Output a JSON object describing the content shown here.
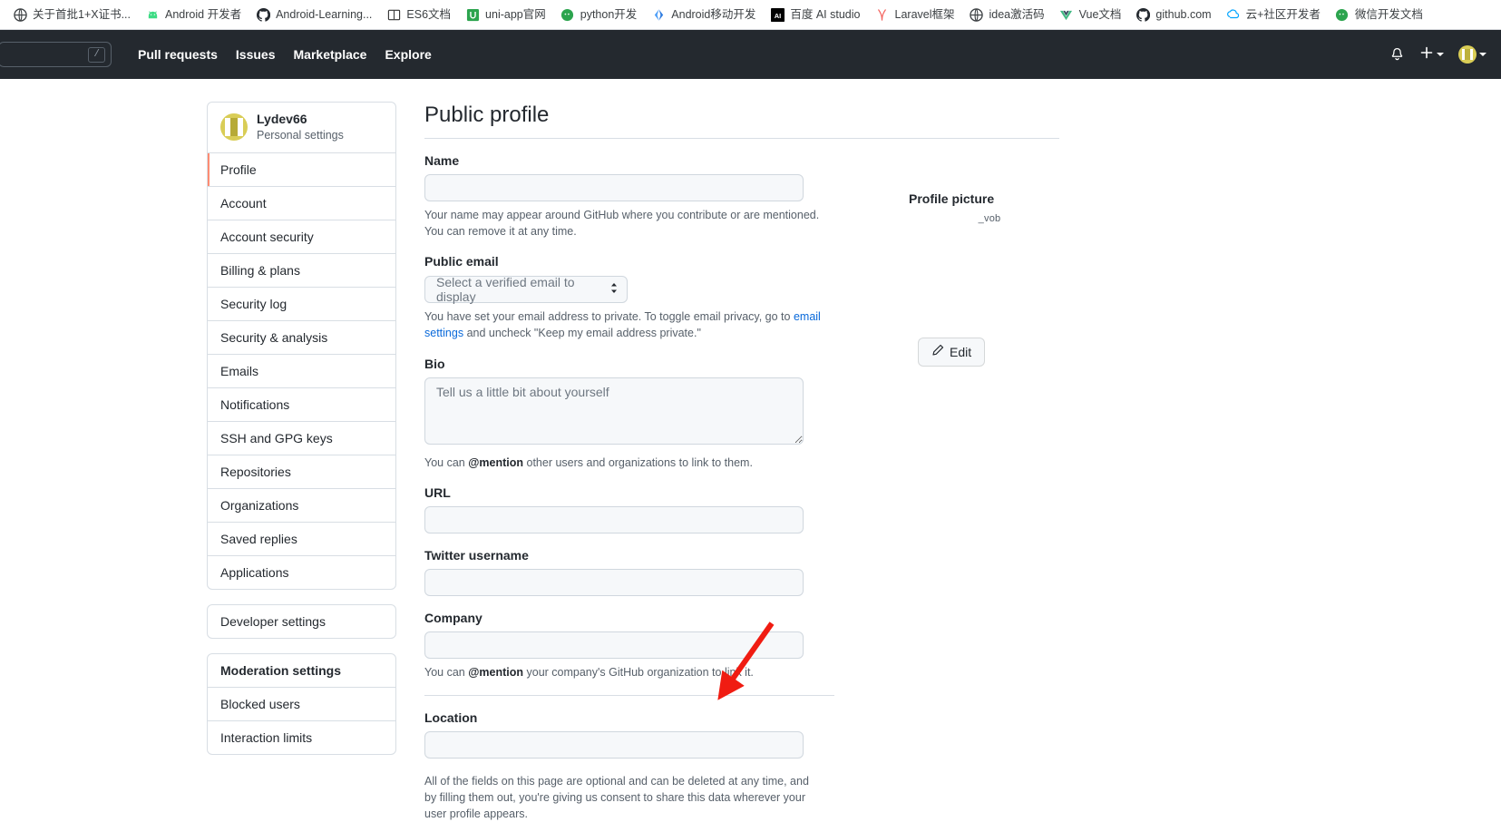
{
  "browser": {
    "bookmarks": [
      {
        "label": "关于首批1+X证书...",
        "icon": "globe-icon",
        "icon_glyph": "◍",
        "color": "#1a73e8"
      },
      {
        "label": "Android 开发者",
        "icon": "android-icon",
        "icon_glyph": "▲",
        "color": "#3ddc84"
      },
      {
        "label": "Android-Learning...",
        "icon": "github-icon",
        "icon_glyph": "",
        "color": "#24292f"
      },
      {
        "label": "ES6文档",
        "icon": "book-icon",
        "icon_glyph": "▥",
        "color": "#333333"
      },
      {
        "label": "uni-app官网",
        "icon": "uniapp-icon",
        "icon_glyph": "U",
        "color": "#2ca44e"
      },
      {
        "label": "python开发",
        "icon": "chat-icon",
        "icon_glyph": "●",
        "color": "#2ca44e"
      },
      {
        "label": "Android移动开发",
        "icon": "csdn-icon",
        "icon_glyph": "✦",
        "color": "#4a9df8"
      },
      {
        "label": "百度 AI studio",
        "icon": "ai-studio-icon",
        "icon_glyph": "AI",
        "color": "#000000"
      },
      {
        "label": "Laravel框架",
        "icon": "laravel-icon",
        "icon_glyph": "✄",
        "color": "#f4645f"
      },
      {
        "label": "idea激活码",
        "icon": "globe-icon",
        "icon_glyph": "◍",
        "color": "#3c4043"
      },
      {
        "label": "Vue文档",
        "icon": "vue-icon",
        "icon_glyph": "▼",
        "color": "#41b883"
      },
      {
        "label": "github.com",
        "icon": "github-icon",
        "icon_glyph": "",
        "color": "#24292f"
      },
      {
        "label": "云+社区开发者",
        "icon": "tencent-cloud-icon",
        "icon_glyph": "◬",
        "color": "#00a4ff"
      },
      {
        "label": "微信开发文档",
        "icon": "wechat-icon",
        "icon_glyph": "●",
        "color": "#2ca44e"
      }
    ]
  },
  "header": {
    "search_shortcut": "/",
    "nav": [
      {
        "label": "Pull requests"
      },
      {
        "label": "Issues"
      },
      {
        "label": "Marketplace"
      },
      {
        "label": "Explore"
      }
    ],
    "notifications_icon": "bell-icon",
    "create_new_icon": "plus-icon",
    "account_icon": "avatar"
  },
  "sidebar": {
    "user": {
      "name": "Lydev66",
      "subtitle": "Personal settings"
    },
    "personal_items": [
      {
        "label": "Profile",
        "selected": true
      },
      {
        "label": "Account",
        "selected": false
      },
      {
        "label": "Account security",
        "selected": false
      },
      {
        "label": "Billing & plans",
        "selected": false
      },
      {
        "label": "Security log",
        "selected": false
      },
      {
        "label": "Security & analysis",
        "selected": false
      },
      {
        "label": "Emails",
        "selected": false
      },
      {
        "label": "Notifications",
        "selected": false
      },
      {
        "label": "SSH and GPG keys",
        "selected": false
      },
      {
        "label": "Repositories",
        "selected": false
      },
      {
        "label": "Organizations",
        "selected": false
      },
      {
        "label": "Saved replies",
        "selected": false
      },
      {
        "label": "Applications",
        "selected": false
      }
    ],
    "developer_item": {
      "label": "Developer settings"
    },
    "moderation": {
      "heading": "Moderation settings",
      "items": [
        {
          "label": "Blocked users"
        },
        {
          "label": "Interaction limits"
        }
      ]
    }
  },
  "main": {
    "title": "Public profile",
    "name_field": {
      "label": "Name",
      "value": "",
      "placeholder": "",
      "hint_1": "Your name may appear around GitHub where you contribute or are mentioned. You can",
      "hint_2": "remove it at any time."
    },
    "public_email": {
      "label": "Public email",
      "selected_option": "Select a verified email to display",
      "caret": "⇅",
      "hint_prefix": "You have set your email address to private. To toggle email privacy, go to ",
      "hint_link": "email settings",
      "hint_suffix_line2": "and uncheck \"Keep my email address private.\""
    },
    "bio": {
      "label": "Bio",
      "value": "",
      "placeholder": "Tell us a little bit about yourself",
      "hint_a": "You can ",
      "hint_mention": "@mention",
      "hint_b": " other users and organizations to link to them."
    },
    "url": {
      "label": "URL",
      "value": "",
      "placeholder": ""
    },
    "twitter": {
      "label": "Twitter username",
      "value": "",
      "placeholder": ""
    },
    "company": {
      "label": "Company",
      "value": "",
      "placeholder": "",
      "hint_a": "You can ",
      "hint_mention": "@mention",
      "hint_b": " your company's GitHub organization to link it."
    },
    "location": {
      "label": "Location",
      "value": "",
      "placeholder": ""
    },
    "footer_note_1": "All of the fields on this page are optional and can be deleted at any time, and by filling",
    "footer_note_2": "them out, you're giving us consent to share this data wherever your user profile appears."
  },
  "profile_picture": {
    "title": "Profile picture",
    "broken_image_alt": "_vob",
    "edit_label": "Edit",
    "edit_icon": "pencil-icon"
  },
  "annotation": {
    "arrow_color": "#f01c12",
    "points_to": "Developer settings"
  },
  "colors": {
    "header_bg": "#24292f",
    "accent_selected": "#fd8c73",
    "link": "#0969da",
    "border": "#d8dee4",
    "input_bg": "#f6f8fa",
    "avatar": "#d9cd56"
  }
}
